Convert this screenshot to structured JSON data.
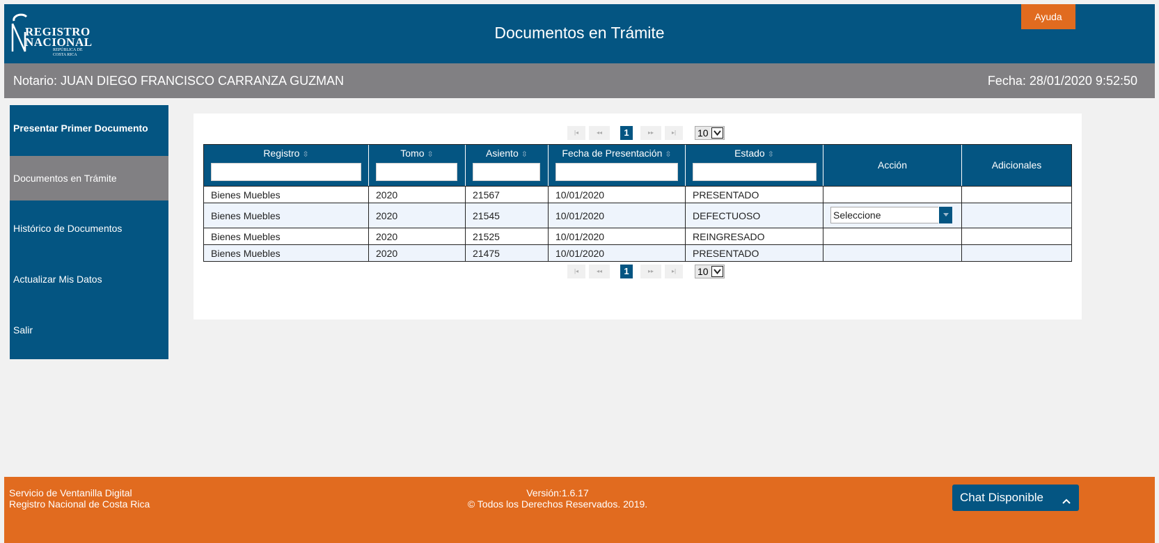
{
  "header": {
    "logo_line1": "REGISTRO",
    "logo_line2": "NACIONAL",
    "logo_sub1": "REPÚBLICA DE",
    "logo_sub2": "COSTA RICA",
    "title": "Documentos en Trámite",
    "help_label": "Ayuda"
  },
  "userbar": {
    "notario": "Notario: JUAN DIEGO FRANCISCO CARRANZA GUZMAN",
    "fecha": "Fecha: 28/01/2020 9:52:50"
  },
  "sidebar": {
    "items": [
      {
        "label": "Presentar Primer Documento"
      },
      {
        "label": "Documentos en Trámite"
      },
      {
        "label": "Histórico de Documentos"
      },
      {
        "label": "Actualizar Mis Datos"
      },
      {
        "label": "Salir"
      }
    ],
    "active_index": 1
  },
  "pager": {
    "current_page": "1",
    "rows_per_page": "10"
  },
  "table": {
    "columns": [
      "Registro",
      "Tomo",
      "Asiento",
      "Fecha de Presentación",
      "Estado",
      "Acción",
      "Adicionales"
    ],
    "rows": [
      {
        "registro": "Bienes Muebles",
        "tomo": "2020",
        "asiento": "21567",
        "fecha": "10/01/2020",
        "estado": "PRESENTADO",
        "accion": "",
        "adicionales": ""
      },
      {
        "registro": "Bienes Muebles",
        "tomo": "2020",
        "asiento": "21545",
        "fecha": "10/01/2020",
        "estado": "DEFECTUOSO",
        "accion": "Seleccione",
        "adicionales": ""
      },
      {
        "registro": "Bienes Muebles",
        "tomo": "2020",
        "asiento": "21525",
        "fecha": "10/01/2020",
        "estado": "REINGRESADO",
        "accion": "",
        "adicionales": ""
      },
      {
        "registro": "Bienes Muebles",
        "tomo": "2020",
        "asiento": "21475",
        "fecha": "10/01/2020",
        "estado": "PRESENTADO",
        "accion": "",
        "adicionales": ""
      }
    ]
  },
  "footer": {
    "left1": "Servicio de Ventanilla Digital",
    "left2": "Registro Nacional de Costa Rica",
    "version": "Versión:1.6.17",
    "rights": "© Todos los Derechos Reservados. 2019.",
    "chat_label": "Chat Disponible"
  },
  "colors": {
    "primary_blue": "#045582",
    "accent_orange": "#e16b1f",
    "gray_bar": "#818083",
    "background": "#f1f1f1"
  }
}
